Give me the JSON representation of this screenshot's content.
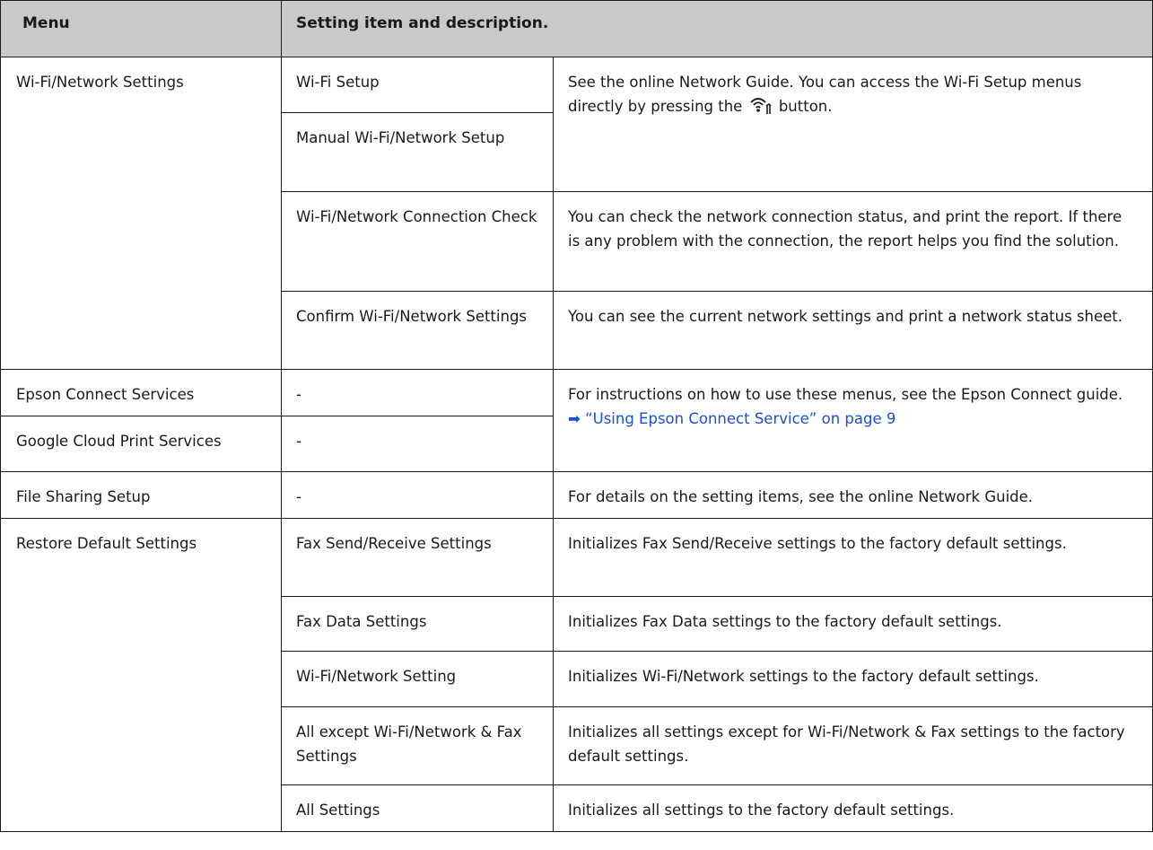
{
  "header": {
    "menu": "Menu",
    "setting": "Setting item and description."
  },
  "rows": {
    "wifi": {
      "menu": "Wi-Fi/Network Settings",
      "items": [
        "Wi-Fi Setup",
        "Manual Wi-Fi/Network Setup",
        "Wi-Fi/Network Connection Check",
        "Confirm Wi-Fi/Network Settings"
      ],
      "desc_setup_a": "See the online Network Guide. You can access the Wi-Fi Setup menus directly by pressing the",
      "desc_setup_b": "button.",
      "desc_check": "You can check the network connection status, and print the report. If there is any problem with the connection, the report helps you find the solution.",
      "desc_confirm": "You can see the current network settings and print a network status sheet."
    },
    "epson": {
      "menu": "Epson Connect Services",
      "item": "-",
      "desc": "For instructions on how to use these menus, see the Epson Connect guide.",
      "link_arrow": "➡",
      "link_text": "“Using Epson Connect Service” on page 9"
    },
    "google": {
      "menu": "Google Cloud Print Services",
      "item": "-"
    },
    "file": {
      "menu": "File Sharing Setup",
      "item": "-",
      "desc": "For details on the setting items, see the online Network Guide."
    },
    "restore": {
      "menu": "Restore Default Settings",
      "items": [
        {
          "item": "Fax Send/Receive Settings",
          "desc": "Initializes Fax Send/Receive settings to the factory default settings."
        },
        {
          "item": "Fax Data Settings",
          "desc": "Initializes Fax Data settings to the factory default settings."
        },
        {
          "item": "Wi-Fi/Network Setting",
          "desc": "Initializes Wi-Fi/Network settings to the factory default settings."
        },
        {
          "item": "All except Wi-Fi/Network & Fax Settings",
          "desc": "Initializes all settings except for Wi-Fi/Network & Fax settings to the factory default settings."
        },
        {
          "item": "All Settings",
          "desc": "Initializes all settings to the factory default settings."
        }
      ]
    }
  },
  "icons": {
    "wifi_button": "wifi-setup-icon"
  },
  "colors": {
    "header_bg": "#c9c9c9",
    "link": "#1a4fd8",
    "border": "#1a1a1a"
  }
}
